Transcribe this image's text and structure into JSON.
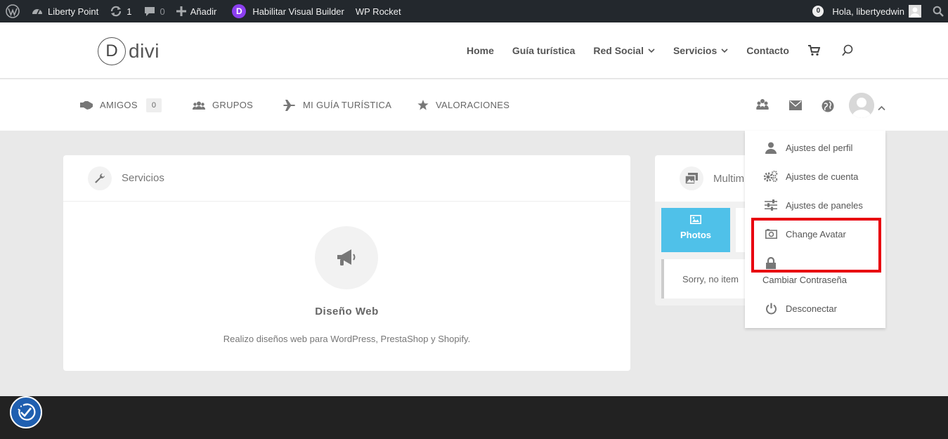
{
  "adminbar": {
    "site_name": "Liberty Point",
    "updates_count": "1",
    "comments_count": "0",
    "add_label": "Añadir",
    "divi_letter": "D",
    "visual_builder_label": "Habilitar Visual Builder",
    "wp_rocket_label": "WP Rocket",
    "notifications_count": "0",
    "greeting": "Hola, libertyedwin"
  },
  "header": {
    "logo_letter": "D",
    "logo_text": "divi",
    "nav": [
      {
        "label": "Home"
      },
      {
        "label": "Guía turística"
      },
      {
        "label": "Red Social"
      },
      {
        "label": "Servicios"
      },
      {
        "label": "Contacto"
      }
    ]
  },
  "subnav": {
    "items": [
      {
        "label": "AMIGOS",
        "count": "0"
      },
      {
        "label": "GRUPOS"
      },
      {
        "label": "MI GUÍA TURÍSTICA"
      },
      {
        "label": "VALORACIONES"
      }
    ]
  },
  "services_card": {
    "title": "Servicios",
    "service_name": "Diseño Web",
    "service_desc": "Realizo diseños web para WordPress, PrestaShop y Shopify."
  },
  "media_card": {
    "title": "Multim",
    "photos_label": "Photos",
    "empty_text": "Sorry, no item"
  },
  "dropdown": {
    "items": [
      {
        "label": "Ajustes del perfil"
      },
      {
        "label": "Ajustes de cuenta"
      },
      {
        "label": "Ajustes de paneles"
      },
      {
        "label": "Change Avatar"
      },
      {
        "label": "Cambiar Contraseña"
      },
      {
        "label": "Desconectar"
      }
    ]
  },
  "colors": {
    "accent": "#4fc1e9",
    "highlight_box": "#e8000f",
    "adminbar_bg": "#23282d",
    "footer_bg": "#222222"
  },
  "icons": [
    "wordpress-icon",
    "dashboard-icon",
    "updates-icon",
    "comments-icon",
    "plus-icon",
    "divi-icon",
    "notification-badge",
    "search-icon",
    "cart-icon",
    "handshake-icon",
    "users-icon",
    "plane-icon",
    "star-icon",
    "groups-icon",
    "mail-icon",
    "globe-icon",
    "wrench-icon",
    "megaphone-icon",
    "images-icon",
    "person-icon",
    "gears-icon",
    "sliders-icon",
    "camera-icon",
    "lock-icon",
    "power-icon",
    "accessibility-icon"
  ]
}
